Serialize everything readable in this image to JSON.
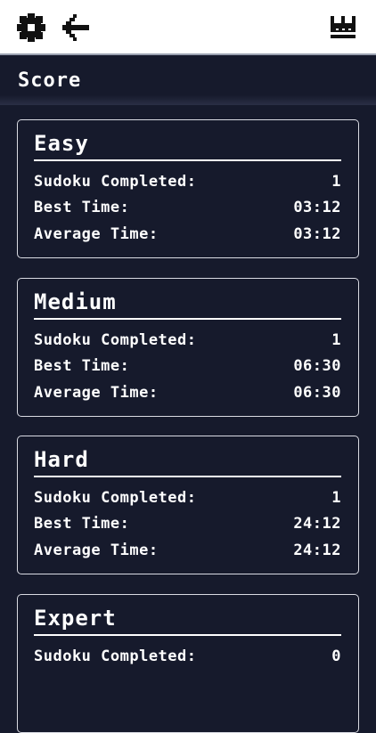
{
  "toolbar": {
    "settings_icon": "gear-icon",
    "back_icon": "arrow-left-icon",
    "leaderboard_icon": "crown-icon"
  },
  "header": {
    "title": "Score"
  },
  "colors": {
    "background": "#161a2c",
    "toolbar": "#ffffff",
    "text": "#ffffff",
    "card_border": "#d9dbe3"
  },
  "cards": [
    {
      "title": "Easy",
      "completed_label": "Sudoku Completed:",
      "completed_value": "1",
      "best_label": "Best Time:",
      "best_value": "03:12",
      "average_label": "Average Time:",
      "average_value": "03:12"
    },
    {
      "title": "Medium",
      "completed_label": "Sudoku Completed:",
      "completed_value": "1",
      "best_label": "Best Time:",
      "best_value": "06:30",
      "average_label": "Average Time:",
      "average_value": "06:30"
    },
    {
      "title": "Hard",
      "completed_label": "Sudoku Completed:",
      "completed_value": "1",
      "best_label": "Best Time:",
      "best_value": "24:12",
      "average_label": "Average Time:",
      "average_value": "24:12"
    },
    {
      "title": "Expert",
      "completed_label": "Sudoku Completed:",
      "completed_value": "0"
    }
  ]
}
